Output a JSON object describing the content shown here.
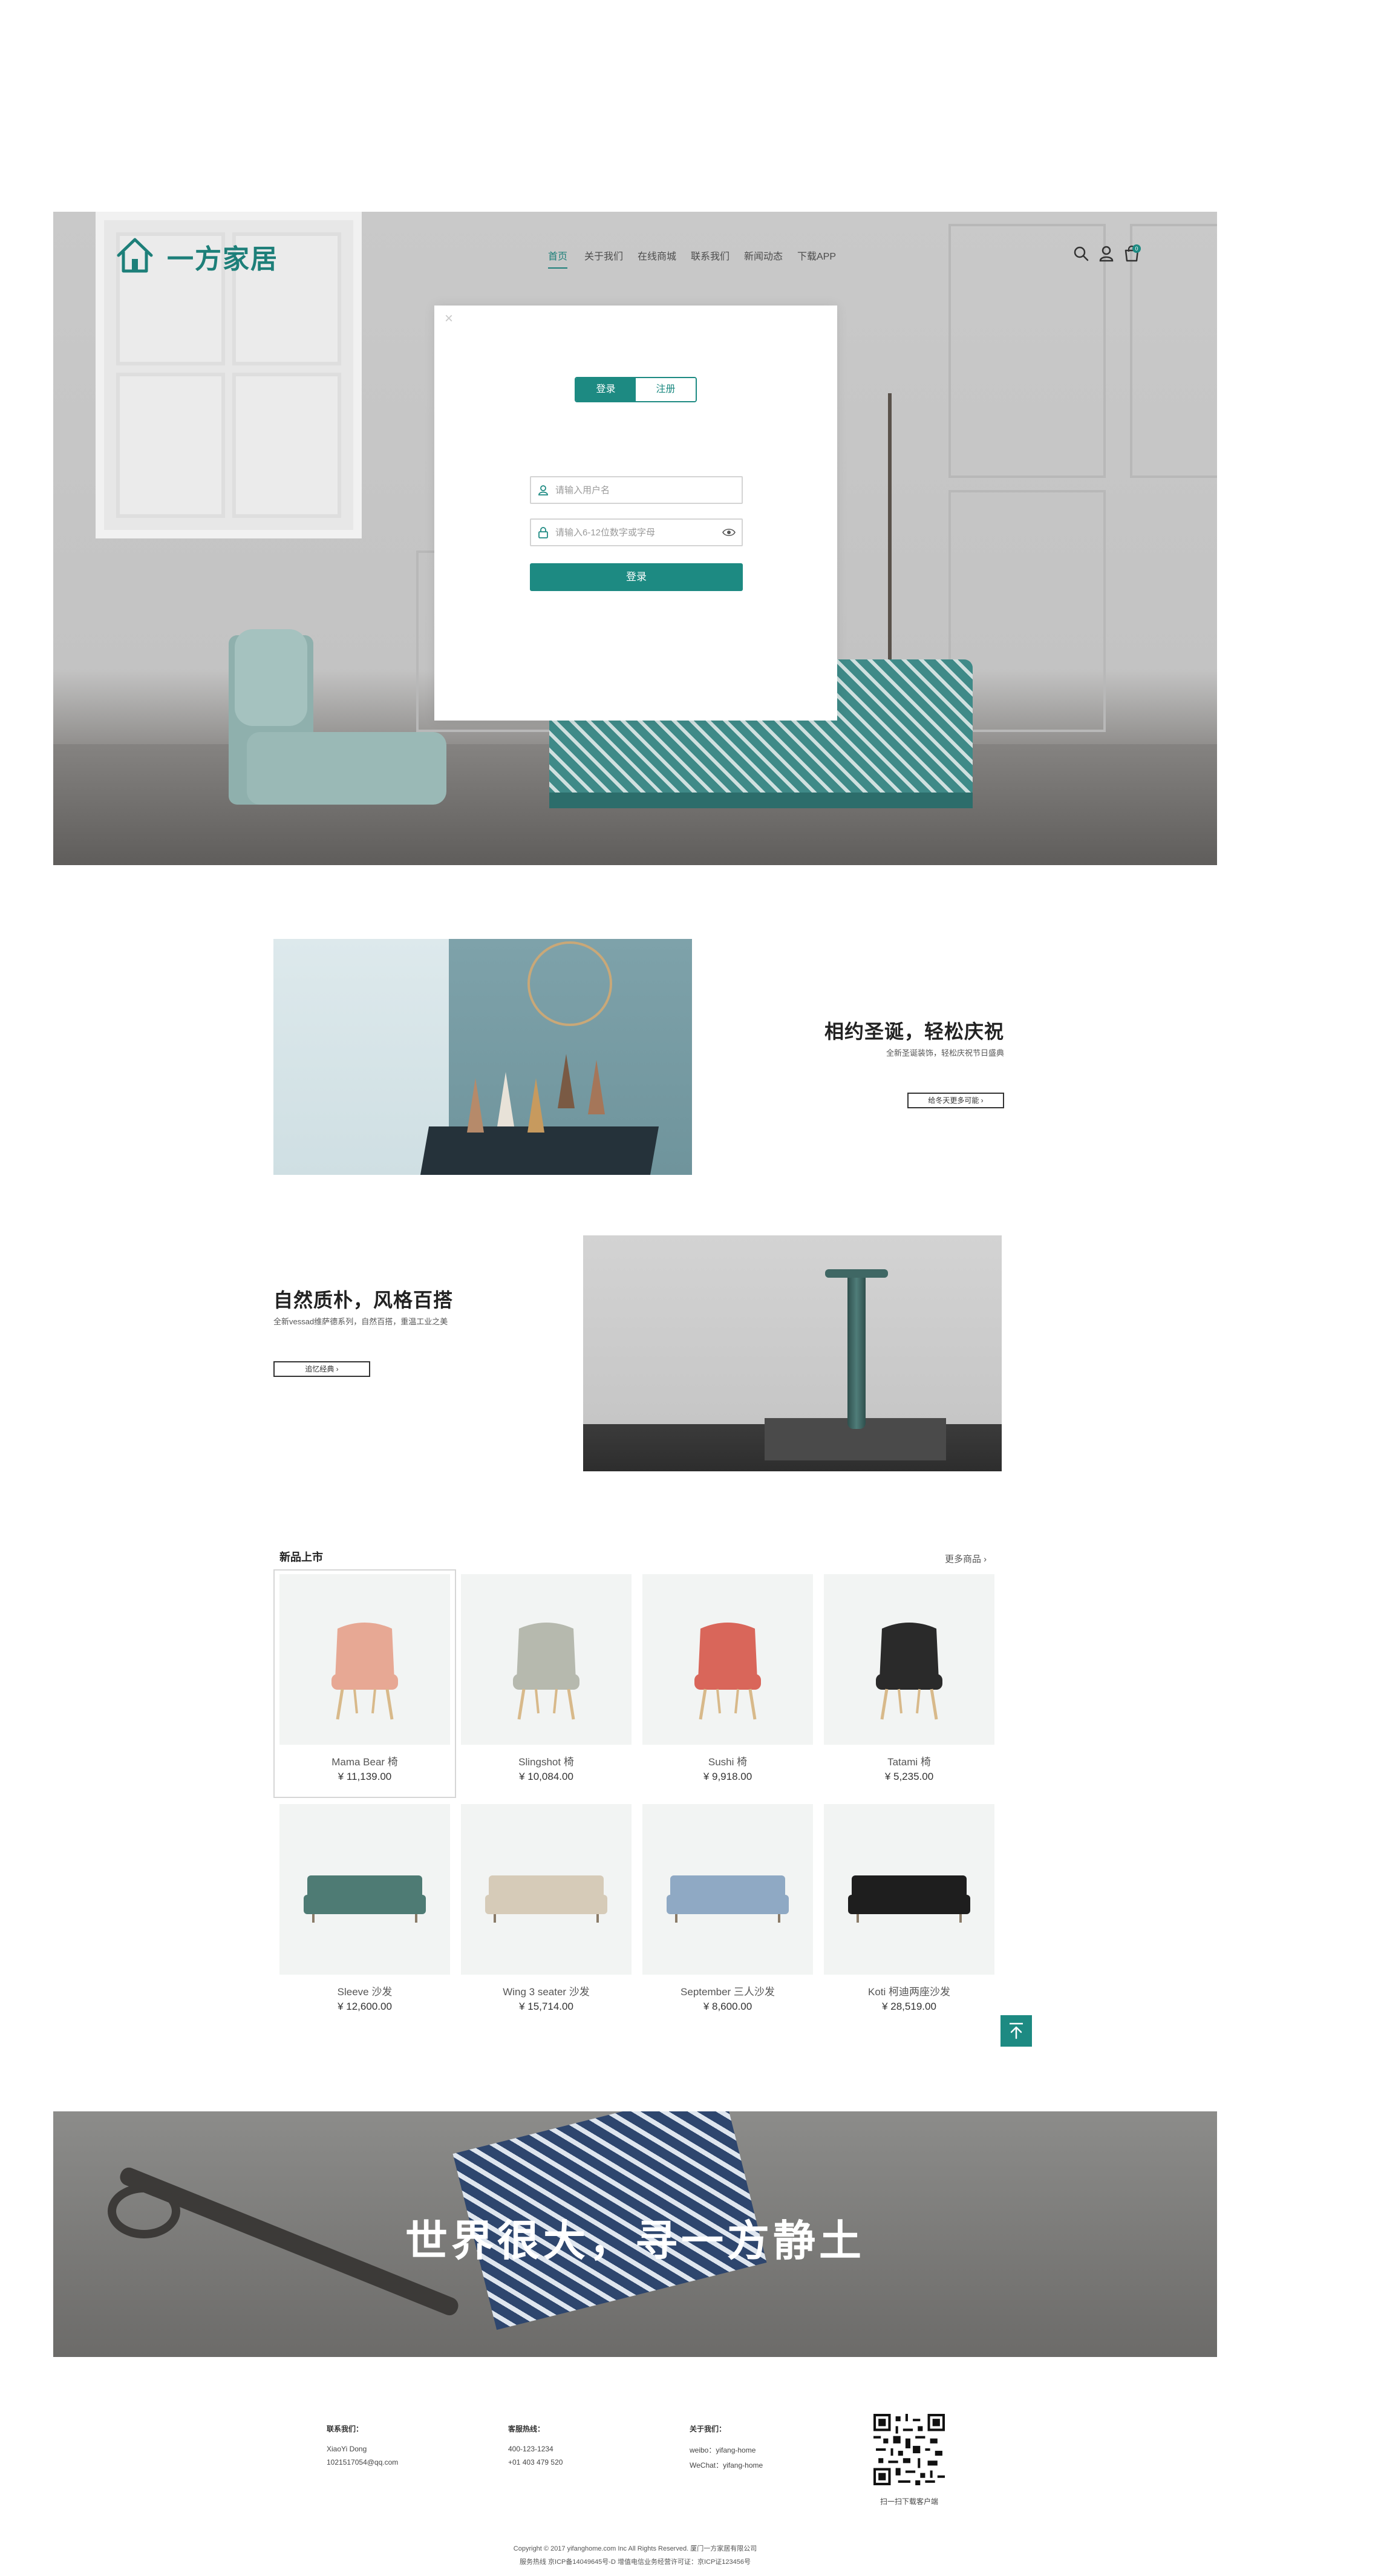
{
  "brand": {
    "name": "一方家居",
    "accent": "#1d8a82"
  },
  "nav": {
    "items": [
      {
        "label": "首页",
        "active": true
      },
      {
        "label": "关于我们",
        "active": false
      },
      {
        "label": "在线商城",
        "active": false
      },
      {
        "label": "联系我们",
        "active": false
      },
      {
        "label": "新闻动态",
        "active": false
      },
      {
        "label": "下载APP",
        "active": false
      }
    ],
    "icons": [
      "search-icon",
      "user-icon",
      "cart-icon"
    ],
    "cart_count": "0"
  },
  "modal": {
    "tabs": {
      "login": "登录",
      "register": "注册"
    },
    "username_placeholder": "请输入用户名",
    "password_placeholder": "请输入6-12位数字或字母",
    "submit_label": "登录"
  },
  "features": [
    {
      "title": "相约圣诞，轻松庆祝",
      "subtitle": "全新圣诞装饰，轻松庆祝节日盛典",
      "button": "给冬天更多可能"
    },
    {
      "title": "自然质朴，风格百搭",
      "subtitle": "全新vessad维萨德系列，自然百搭，重温工业之美",
      "button": "追忆经典"
    }
  ],
  "new_products": {
    "title": "新品上市",
    "more": "更多商品",
    "items": [
      {
        "name": "Mama Bear 椅",
        "price": "¥ 11,139.00",
        "color": "#e7a894"
      },
      {
        "name": "Slingshot 椅",
        "price": "¥ 10,084.00",
        "color": "#b6b9ae"
      },
      {
        "name": "Sushi 椅",
        "price": "¥ 9,918.00",
        "color": "#d9665a"
      },
      {
        "name": "Tatami 椅",
        "price": "¥ 5,235.00",
        "color": "#2a2a2a"
      },
      {
        "name": "Sleeve 沙发",
        "price": "¥ 12,600.00",
        "color": "#4e7b74"
      },
      {
        "name": "Wing 3 seater 沙发",
        "price": "¥ 15,714.00",
        "color": "#d6cbb8"
      },
      {
        "name": "September 三人沙发",
        "price": "¥ 8,600.00",
        "color": "#8fa9c4"
      },
      {
        "name": "Koti 柯迪两座沙发",
        "price": "¥ 28,519.00",
        "color": "#1e1e1e"
      }
    ]
  },
  "banner": {
    "text": "世界很大，寻一方静土"
  },
  "footer": {
    "columns": [
      {
        "title": "联系我们：",
        "lines": [
          "XiaoYi Dong",
          "1021517054@qq.com"
        ]
      },
      {
        "title": "客服热线：",
        "lines": [
          "400-123-1234",
          "+01 403 479 520"
        ]
      },
      {
        "title": "关于我们：",
        "lines": [
          "weibo：yifang-home",
          "WeChat：yifang-home"
        ]
      }
    ],
    "qr_label": "扫一扫下载客户端",
    "copyright": "Copyright © 2017 yifanghome.com Inc All Rights Reserved. 厦门一方家居有限公司",
    "icp": "服务热线 京ICP备14049645号-D 增值电信业务经营许可证：京ICP证123456号"
  }
}
